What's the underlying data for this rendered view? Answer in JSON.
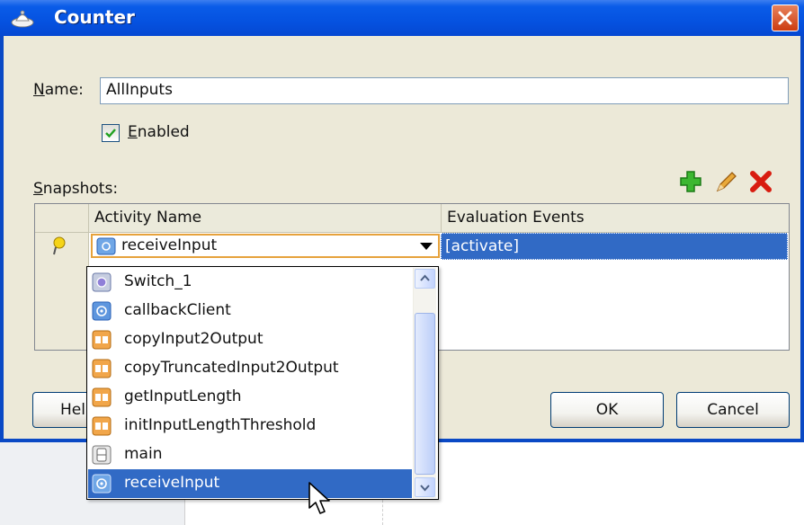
{
  "dialog": {
    "title": "Counter",
    "name_label_prefix": "N",
    "name_label_rest": "ame:",
    "name_value": "AllInputs",
    "enabled_label_prefix": "E",
    "enabled_label_rest": "nabled",
    "enabled_checked": true,
    "snapshots_label_prefix": "S",
    "snapshots_label_rest": "napshots:"
  },
  "toolbar": {
    "add_icon": "add-icon",
    "edit_icon": "pencil-icon",
    "delete_icon": "delete-icon"
  },
  "table": {
    "columns": [
      "Activity Name",
      "Evaluation Events"
    ],
    "rows": [
      {
        "activity": "receiveInput",
        "events": "[activate]"
      }
    ]
  },
  "dropdown": {
    "items": [
      {
        "label": "Switch_1",
        "icon": "switch-icon"
      },
      {
        "label": "callbackClient",
        "icon": "invoke-icon"
      },
      {
        "label": "copyInput2Output",
        "icon": "assign-icon"
      },
      {
        "label": "copyTruncatedInput2Output",
        "icon": "assign-icon"
      },
      {
        "label": "getInputLength",
        "icon": "assign-icon"
      },
      {
        "label": "initInputLengthThreshold",
        "icon": "assign-icon"
      },
      {
        "label": "main",
        "icon": "scope-icon"
      },
      {
        "label": "receiveInput",
        "icon": "receive-icon"
      }
    ],
    "selected": "receiveInput"
  },
  "buttons": {
    "help": "Hel",
    "ok": "OK",
    "cancel": "Cancel"
  },
  "colors": {
    "titlebar": "#0a5ce8",
    "selection": "#316ac5",
    "dialog_bg": "#ece9d8"
  }
}
